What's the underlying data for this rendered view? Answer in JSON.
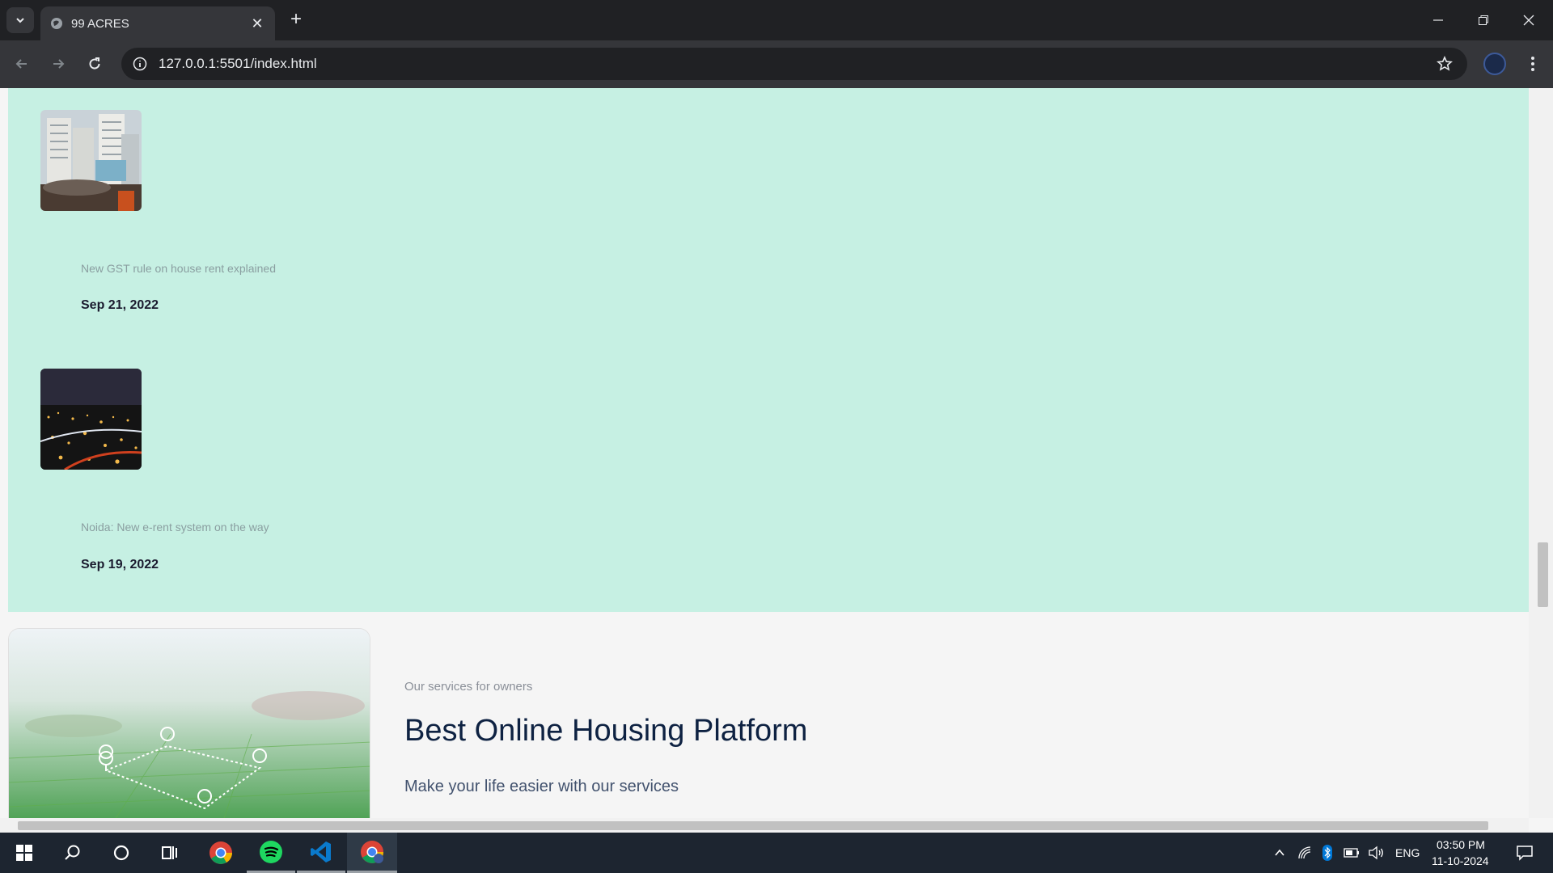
{
  "browser": {
    "tab_title": "99 ACRES",
    "url": "127.0.0.1:5501/index.html"
  },
  "news": [
    {
      "title": "New GST rule on house rent explained",
      "date": "Sep 21, 2022",
      "image": "buildings-photo"
    },
    {
      "title": "Noida: New e-rent system on the way",
      "date": "Sep 19, 2022",
      "image": "night-city-photo"
    }
  ],
  "services": {
    "kicker": "Our services for owners",
    "title": "Best Online Housing Platform",
    "subtitle": "Make your life easier with our services",
    "image": "aerial-fields-map-photo"
  },
  "taskbar": {
    "language": "ENG",
    "time": "03:50 PM",
    "date": "11-10-2024"
  },
  "colors": {
    "news_bg": "#c6f0e3",
    "page_bg": "#f5f5f5",
    "title_color": "#0e2242"
  }
}
